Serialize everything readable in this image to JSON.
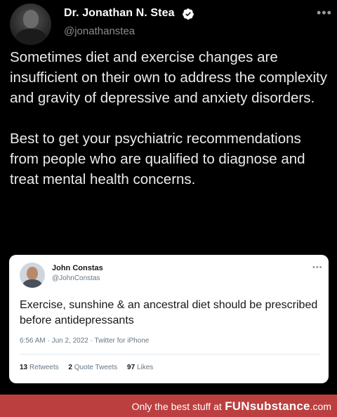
{
  "tweet": {
    "author_name": "Dr. Jonathan N. Stea",
    "author_handle": "@jonathanstea",
    "more_label": "•••",
    "paragraphs": [
      "Sometimes diet and exercise changes are insufficient on their own to address the complexity and gravity of depressive and anxiety disorders.",
      "Best to get your psychiatric recommendations from people who are qualified to diagnose and treat mental health concerns."
    ],
    "verified_icon": "verified-badge-icon",
    "verified_color": "#ffffff"
  },
  "quoted": {
    "author_name": "John Constas",
    "author_handle": "@JohnConstas",
    "more_label": "•••",
    "text": "Exercise, sunshine & an ancestral diet should be prescribed before antidepressants",
    "meta": "6:56 AM · Jun 2, 2022 · Twitter for iPhone",
    "retweets_count": "13",
    "retweets_label": "Retweets",
    "quotes_count": "2",
    "quotes_label": "Quote Tweets",
    "likes_count": "97",
    "likes_label": "Likes"
  },
  "banner": {
    "prefix": "Only the best stuff at",
    "brand_fun": "FUN",
    "brand_substance": "substance",
    "suffix": ".com",
    "color": "#bc3f3f"
  }
}
